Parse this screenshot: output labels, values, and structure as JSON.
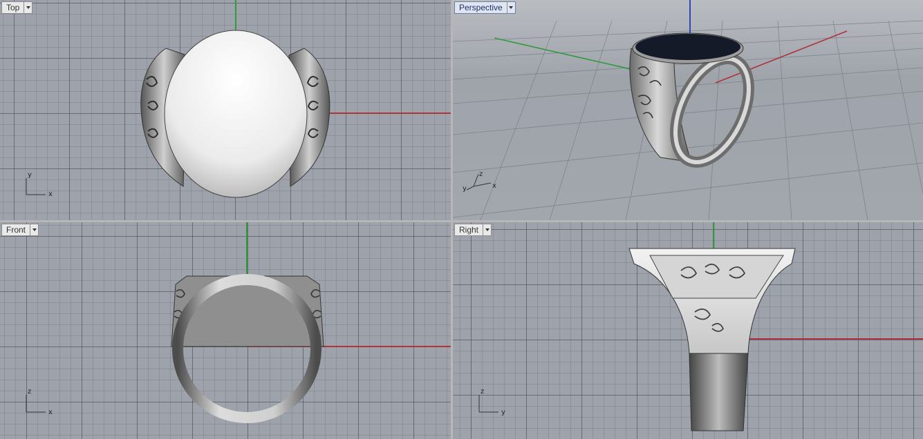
{
  "viewports": {
    "top": {
      "label": "Top"
    },
    "perspective": {
      "label": "Perspective"
    },
    "front": {
      "label": "Front"
    },
    "right": {
      "label": "Right"
    }
  },
  "axes_labels": {
    "top": {
      "a": "y",
      "b": "x"
    },
    "perspective": {
      "a": "z",
      "b": "y",
      "c": "x"
    },
    "front": {
      "a": "z",
      "b": "x"
    },
    "right": {
      "a": "z",
      "b": "y"
    }
  },
  "colors": {
    "x_axis": "#b0333a",
    "y_axis": "#2f9a3a",
    "z_axis": "#3344b5",
    "active_tab": "#dfe6f1"
  },
  "icons": [
    "dropdown-arrow-icon",
    "axis-gizmo-icon"
  ]
}
